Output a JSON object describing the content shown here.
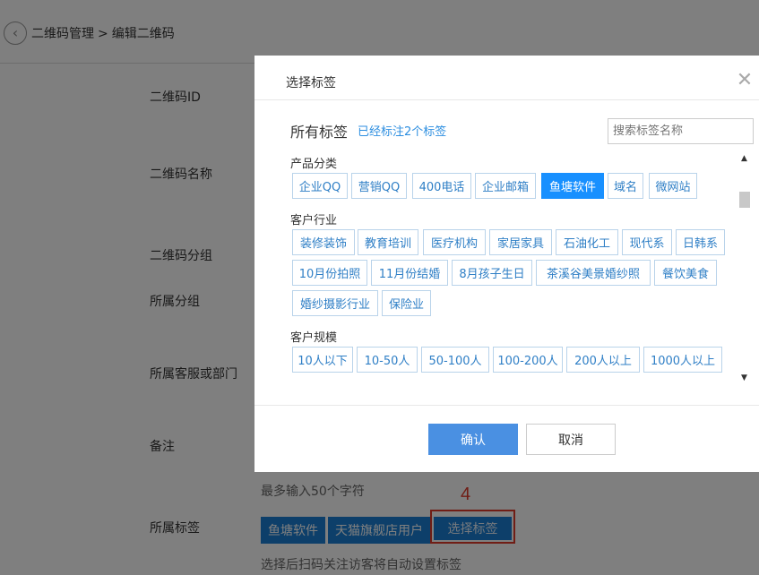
{
  "breadcrumb": {
    "root": "二维码管理",
    "separator": ">",
    "current": "编辑二维码"
  },
  "form": {
    "labels": {
      "id": "二维码ID",
      "name": "二维码名称",
      "group": "二维码分组",
      "belong_group": "所属分组",
      "dept": "所属客服或部门",
      "note": "备注",
      "tags": "所属标签"
    },
    "note_hint": "最多输入50个字符",
    "assigned_tags": [
      "鱼塘软件",
      "天猫旗舰店用户"
    ],
    "select_tag_button": "选择标签",
    "tags_hint": "选择后扫码关注访客将自动设置标签",
    "step_number": "4"
  },
  "modal": {
    "title": "选择标签",
    "close_icon": "close-icon",
    "all_tags": "所有标签",
    "tagged_count": "已经标注2个标签",
    "search_placeholder": "搜索标签名称",
    "categories": [
      {
        "title": "产品分类",
        "tags": [
          "企业QQ",
          "营销QQ",
          "400电话",
          "企业邮箱",
          "鱼塘软件",
          "域名",
          "微网站"
        ],
        "selected": [
          "鱼塘软件"
        ]
      },
      {
        "title": "客户行业",
        "tags": [
          "装修装饰",
          "教育培训",
          "医疗机构",
          "家居家具",
          "石油化工",
          "现代系",
          "日韩系",
          "10月份拍照",
          "11月份结婚",
          "8月孩子生日",
          "茶溪谷美景婚纱照",
          "餐饮美食",
          "婚纱摄影行业",
          "保险业"
        ]
      },
      {
        "title": "客户规模",
        "tags": [
          "10人以下",
          "10-50人",
          "50-100人",
          "100-200人",
          "200人以上",
          "1000人以上"
        ]
      }
    ],
    "confirm": "确认",
    "cancel": "取消"
  },
  "colors": {
    "accent": "#1890ff",
    "confirm": "#4a90e2",
    "tag_chip": "#1a7fd4",
    "highlight": "#e03a2a"
  }
}
